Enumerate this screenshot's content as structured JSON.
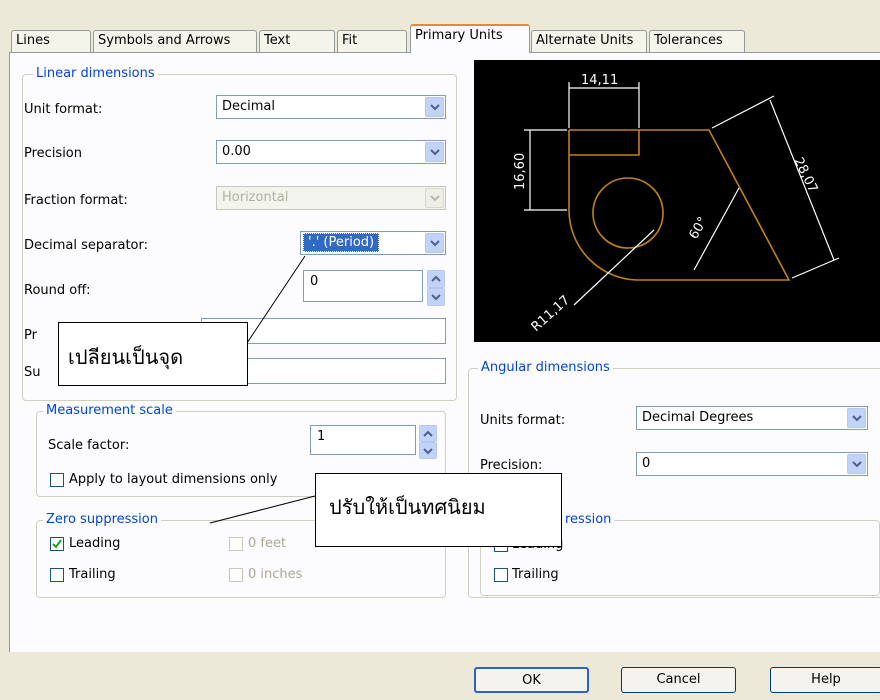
{
  "tabs": [
    {
      "label": "Lines"
    },
    {
      "label": "Symbols and Arrows"
    },
    {
      "label": "Text"
    },
    {
      "label": "Fit"
    },
    {
      "label": "Primary Units"
    },
    {
      "label": "Alternate Units"
    },
    {
      "label": "Tolerances"
    }
  ],
  "linear": {
    "title": "Linear dimensions",
    "unit_format_label": "Unit format:",
    "unit_format_value": "Decimal",
    "precision_label": "Precision",
    "precision_value": "0.00",
    "fraction_label": "Fraction format:",
    "fraction_value": "Horizontal",
    "decimal_sep_label": "Decimal separator:",
    "decimal_sep_value": "'.' (Period)",
    "round_off_label": "Round off:",
    "round_off_value": "0",
    "prefix_label": "Pr",
    "suffix_label": "Su"
  },
  "measurement": {
    "title": "Measurement scale",
    "scale_label": "Scale factor:",
    "scale_value": "1",
    "apply_label": "Apply to layout dimensions only"
  },
  "zero": {
    "title": "Zero suppression",
    "leading": "Leading",
    "trailing": "Trailing",
    "feet": "0 feet",
    "inches": "0 inches"
  },
  "preview": {
    "dim_top": "14,11",
    "dim_left": "16,60",
    "dim_right": "28,07",
    "dim_angle": "60°",
    "dim_radius": "R11,17",
    "line_color": "#c08020",
    "dim_color": "#ffffff"
  },
  "angular": {
    "title": "Angular dimensions",
    "units_label": "Units format:",
    "units_value": "Decimal Degrees",
    "precision_label": "Precision:",
    "precision_value": "0",
    "zero_title": "ression",
    "leading": "Leading",
    "trailing": "Trailing"
  },
  "buttons": {
    "ok": "OK",
    "cancel": "Cancel",
    "help": "Help"
  },
  "annotations": {
    "callout1": "เปลียนเป็นจุด",
    "callout2": "ปรับให้เป็นทศนิยม"
  }
}
